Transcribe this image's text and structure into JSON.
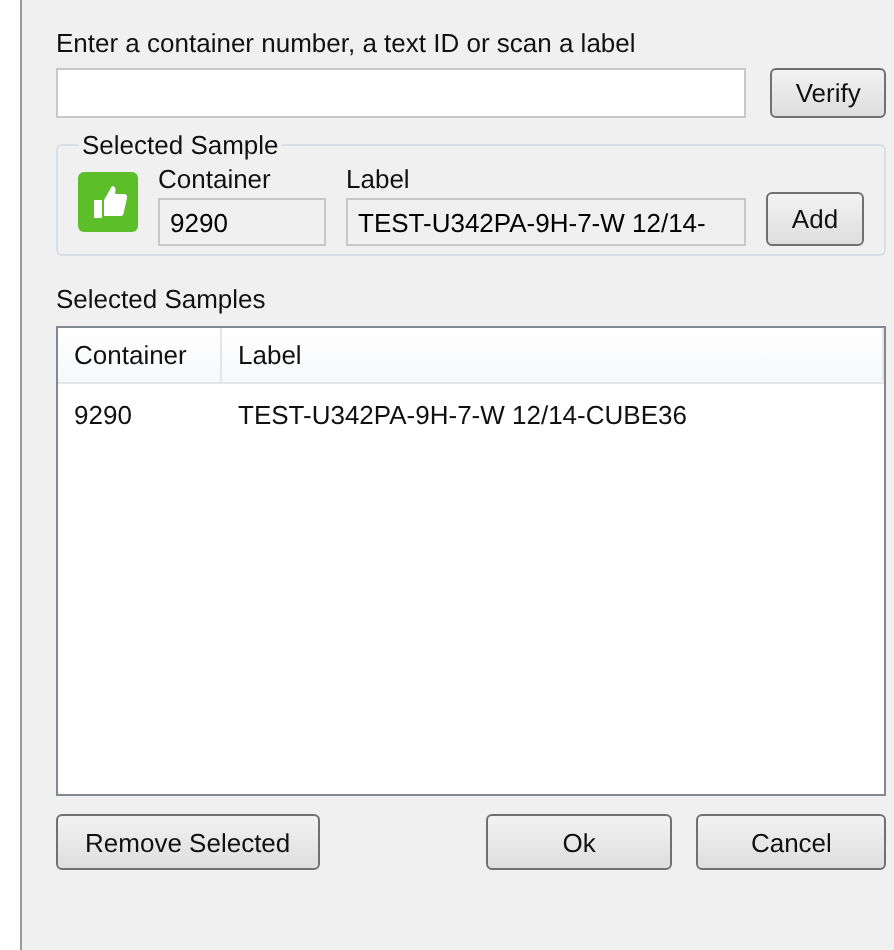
{
  "prompt": "Enter a container number, a text ID or scan a label",
  "verify_button": "Verify",
  "selected_sample": {
    "title": "Selected Sample",
    "verified": true,
    "container_label": "Container",
    "container": "9290",
    "label_label": "Label",
    "label": "TEST-U342PA-9H-7-W 12/14-",
    "add_button": "Add"
  },
  "samples": {
    "title": "Selected Samples",
    "columns": [
      "Container",
      "Label"
    ],
    "rows": [
      [
        "9290",
        "TEST-U342PA-9H-7-W 12/14-CUBE36"
      ]
    ]
  },
  "buttons": [
    "Remove Selected",
    "Ok",
    "Cancel"
  ]
}
